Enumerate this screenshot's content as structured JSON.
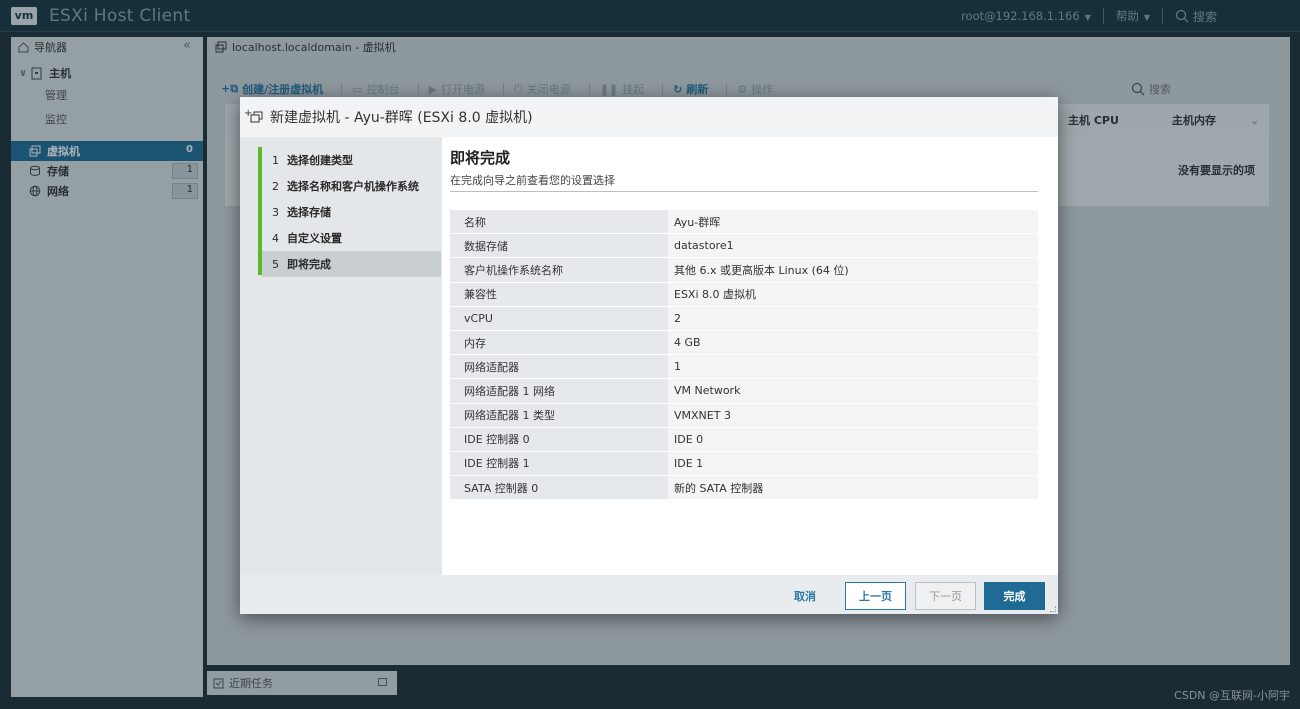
{
  "app": {
    "logo": "vm",
    "title": "ESXi Host Client",
    "user": "root@192.168.1.166",
    "help": "帮助",
    "search": "搜索"
  },
  "navigator": {
    "title": "导航器",
    "host": "主机",
    "host_items": [
      "管理",
      "监控"
    ],
    "categories": [
      {
        "label": "虚拟机",
        "count": "0",
        "selected": true
      },
      {
        "label": "存储",
        "count": "1",
        "selected": false
      },
      {
        "label": "网络",
        "count": "1",
        "selected": false
      }
    ]
  },
  "main": {
    "breadcrumb": "localhost.localdomain - 虚拟机",
    "toolbar": {
      "create": "创建/注册虚拟机",
      "console": "控制台",
      "power_on": "打开电源",
      "power_off": "关闭电源",
      "suspend": "挂起",
      "refresh": "刷新",
      "actions": "操作",
      "search": "搜索"
    },
    "columns": {
      "host_cpu": "主机 CPU",
      "host_mem": "主机内存"
    },
    "empty": "没有要显示的项"
  },
  "tasks": {
    "label": "近期任务"
  },
  "dialog": {
    "title": "新建虚拟机 - Ayu-群晖 (ESXi 8.0 虚拟机)",
    "steps": [
      {
        "num": "1",
        "label": "选择创建类型"
      },
      {
        "num": "2",
        "label": "选择名称和客户机操作系统"
      },
      {
        "num": "3",
        "label": "选择存储"
      },
      {
        "num": "4",
        "label": "自定义设置"
      },
      {
        "num": "5",
        "label": "即将完成"
      }
    ],
    "heading": "即将完成",
    "subtitle": "在完成向导之前查看您的设置选择",
    "summary": [
      {
        "k": "名称",
        "v": "Ayu-群晖"
      },
      {
        "k": "数据存储",
        "v": "datastore1"
      },
      {
        "k": "客户机操作系统名称",
        "v": "其他 6.x 或更高版本 Linux (64 位)"
      },
      {
        "k": "兼容性",
        "v": "ESXi 8.0 虚拟机"
      },
      {
        "k": "vCPU",
        "v": "2"
      },
      {
        "k": "内存",
        "v": "4 GB"
      },
      {
        "k": "网络适配器",
        "v": "1"
      },
      {
        "k": "网络适配器 1 网络",
        "v": "VM Network"
      },
      {
        "k": "网络适配器 1 类型",
        "v": "VMXNET 3"
      },
      {
        "k": "IDE 控制器 0",
        "v": "IDE 0"
      },
      {
        "k": "IDE 控制器 1",
        "v": "IDE 1"
      },
      {
        "k": "SATA 控制器 0",
        "v": "新的 SATA 控制器"
      }
    ],
    "buttons": {
      "cancel": "取消",
      "prev": "上一页",
      "next": "下一页",
      "finish": "完成"
    }
  },
  "watermark": "CSDN @互联网-小阿宇"
}
